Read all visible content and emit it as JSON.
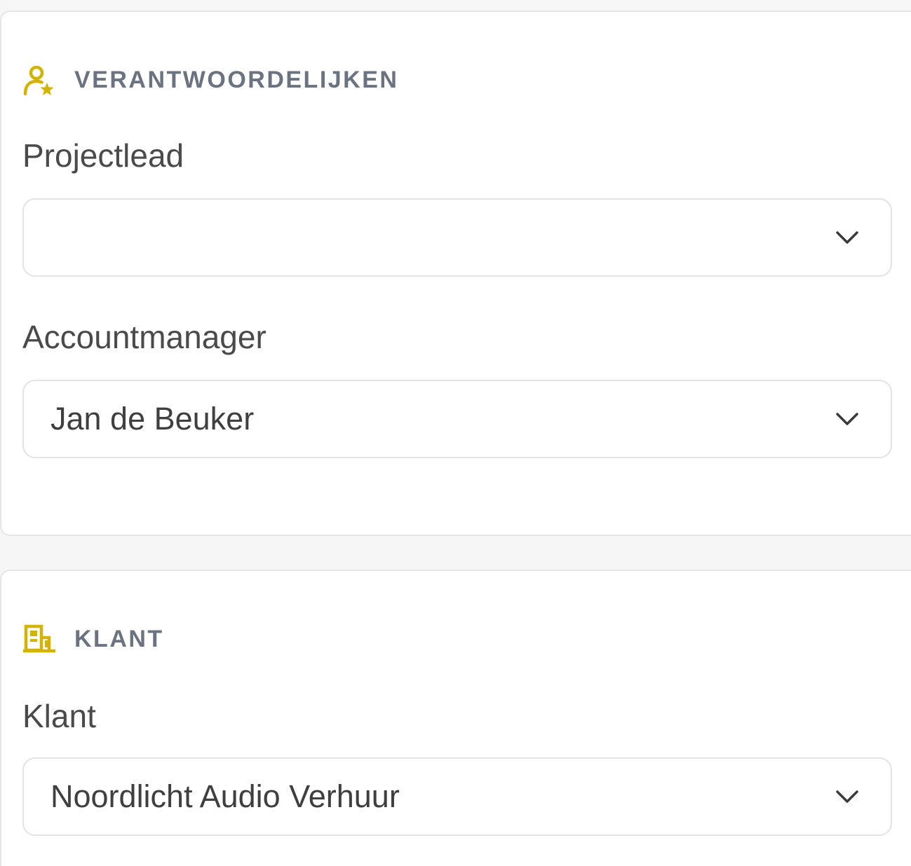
{
  "colors": {
    "accent": "#d4b200",
    "section_title": "#6b7280",
    "text": "#4a4a4a"
  },
  "sections": [
    {
      "title": "VERANTWOORDELIJKEN",
      "icon": "user-star-icon",
      "fields": [
        {
          "label": "Projectlead",
          "value": ""
        },
        {
          "label": "Accountmanager",
          "value": "Jan de Beuker"
        }
      ]
    },
    {
      "title": "KLANT",
      "icon": "building-icon",
      "fields": [
        {
          "label": "Klant",
          "value": "Noordlicht Audio Verhuur"
        }
      ]
    }
  ]
}
